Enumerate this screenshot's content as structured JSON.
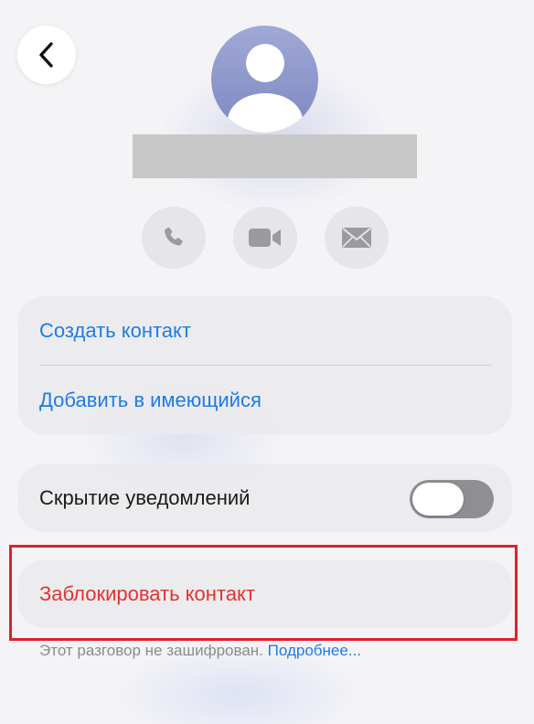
{
  "header": {
    "back_icon": "chevron-left-icon",
    "avatar_icon": "person-icon"
  },
  "actions": [
    {
      "icon": "phone-icon"
    },
    {
      "icon": "video-camera-icon"
    },
    {
      "icon": "envelope-icon"
    }
  ],
  "contact_card": {
    "create_label": "Создать контакт",
    "add_existing_label": "Добавить в имеющийся"
  },
  "notifications_card": {
    "hide_label": "Скрытие уведомлений",
    "toggle_on": false
  },
  "block_card": {
    "block_label": "Заблокировать контакт"
  },
  "footnote": {
    "text": "Этот разговор не зашифрован.",
    "link": "Подробнее..."
  },
  "colors": {
    "accent_blue": "#1f7be6",
    "destructive_red": "#e5312f",
    "highlight_red": "#e0202d"
  }
}
